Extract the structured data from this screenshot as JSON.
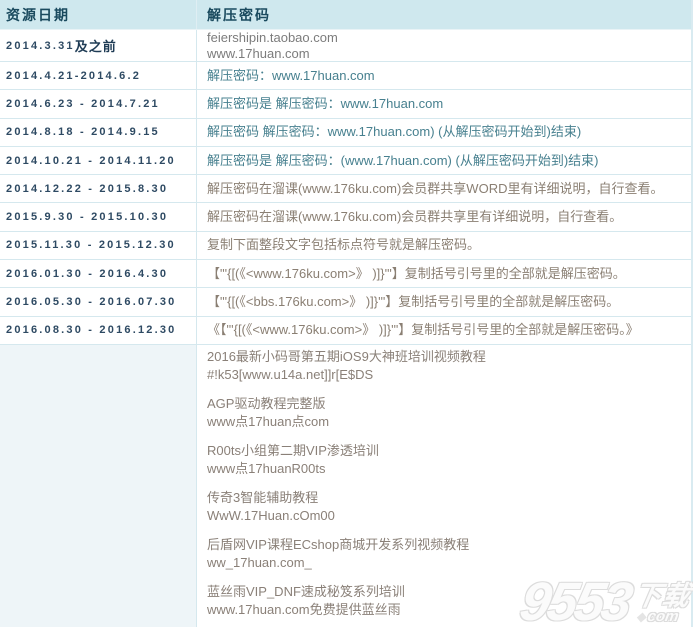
{
  "colors": {
    "header_bg": "#cfe8ee",
    "row_border": "#d5e8ee",
    "header_text": "#1a4a5e",
    "date_text": "#2e4a63",
    "teal_text": "#47808f",
    "brown_text": "#8a7f73",
    "grey_text": "#7c7c7c",
    "footer_cell_bg": "#eef5f8",
    "watermark_outline": "#dcdcdc"
  },
  "header": {
    "date_label": "资源日期",
    "password_label": "解压密码"
  },
  "rows": [
    {
      "date_num": "2014.3.31",
      "date_suffix": "及之前",
      "line1": "feiershipin.taobao.com",
      "line2": "www.17huan.com"
    },
    {
      "date": "2014.4.21-2014.6.2",
      "password": "解压密码：www.17huan.com"
    },
    {
      "date": "2014.6.23 - 2014.7.21",
      "password": "解压密码是 解压密码：www.17huan.com"
    },
    {
      "date": "2014.8.18 - 2014.9.15",
      "password": "解压密码 解压密码：www.17huan.com) (从解压密码开始到)结束)"
    },
    {
      "date": "2014.10.21 - 2014.11.20",
      "password": "解压密码是 解压密码：(www.17huan.com) (从解压密码开始到)结束)"
    },
    {
      "date": "2014.12.22 - 2015.8.30",
      "password": "解压密码在溜课(www.176ku.com)会员群共享WORD里有详细说明，自行查看。"
    },
    {
      "date": "2015.9.30 - 2015.10.30",
      "password": "解压密码在溜课(www.176ku.com)会员群共享里有详细说明，自行查看。"
    },
    {
      "date": "2015.11.30 - 2015.12.30",
      "password": "复制下面整段文字包括标点符号就是解压密码。"
    },
    {
      "date": "2016.01.30 - 2016.4.30",
      "password": "【\"'{[(《<www.176ku.com>》 )]}'\"】复制括号引号里的全部就是解压密码。"
    },
    {
      "date": "2016.05.30 - 2016.07.30",
      "password": "【\"'{[(《<bbs.176ku.com>》 )]}'\"】复制括号引号里的全部就是解压密码。"
    },
    {
      "date": "2016.08.30 - 2016.12.30",
      "password": "《【\"'{[(《<www.176ku.com>》 )]}'\"】复制括号引号里的全部就是解压密码。》"
    }
  ],
  "footer": {
    "groups": [
      {
        "lines": [
          "2016最新小码哥第五期iOS9大神班培训视频教程",
          "#!k53[www.u14a.net]]r[E$DS"
        ]
      },
      {
        "lines": [
          "AGP驱动教程完整版",
          "www点17huan点com"
        ]
      },
      {
        "lines": [
          "R00ts小组第二期VIP渗透培训",
          "www点17huanR00ts"
        ]
      },
      {
        "lines": [
          "传奇3智能辅助教程",
          "WwW.17Huan.cOm00"
        ]
      },
      {
        "lines": [
          "后盾网VIP课程ECshop商城开发系列视频教程",
          "ww_17huan.com_"
        ]
      },
      {
        "lines": [
          "蓝丝雨VIP_DNF速成秘笈系列培训",
          "www.17huan.com免费提供蓝丝雨"
        ]
      }
    ]
  },
  "watermark": {
    "number": "9553",
    "text": "下载",
    "domain": "com"
  }
}
